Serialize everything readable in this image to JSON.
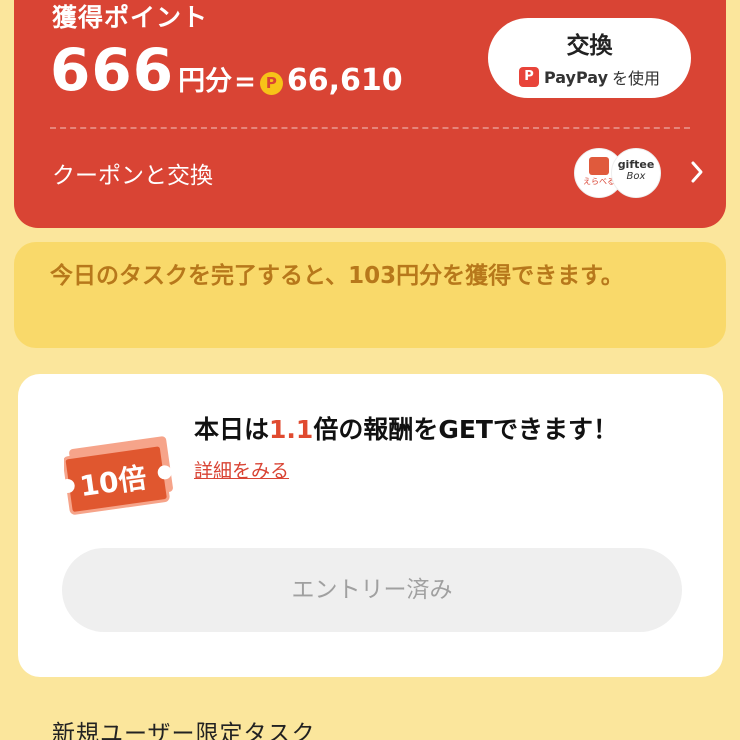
{
  "points": {
    "label": "獲得ポイント",
    "amount": "666",
    "unit": "円分",
    "equals": "=",
    "paypay_icon": "P",
    "paypay_points": "66,610"
  },
  "exchange": {
    "title": "交換",
    "brand_icon": "P",
    "brand": "PayPay",
    "usage": "を使用"
  },
  "coupon": {
    "label": "クーポンと交換",
    "partners": {
      "erabel": "えらべる",
      "giftee_name": "giftee",
      "giftee_box": "Box"
    }
  },
  "task_notice": {
    "text": "今日のタスクを完了すると、103円分を獲得できます。"
  },
  "bonus": {
    "ticket_label": "10倍",
    "headline_pre": "本日は",
    "multiplier": "1.1",
    "headline_post": "倍の報酬をGETできます！",
    "details_link": "詳細をみる",
    "entry_button": "エントリー済み"
  },
  "section": {
    "title": "新規ユーザー限定タスク"
  },
  "colors": {
    "background": "#fbe69c",
    "points_card": "#d94434",
    "notice": "#f9d96a",
    "notice_text": "#b7781b",
    "accent": "#e04a2f"
  }
}
